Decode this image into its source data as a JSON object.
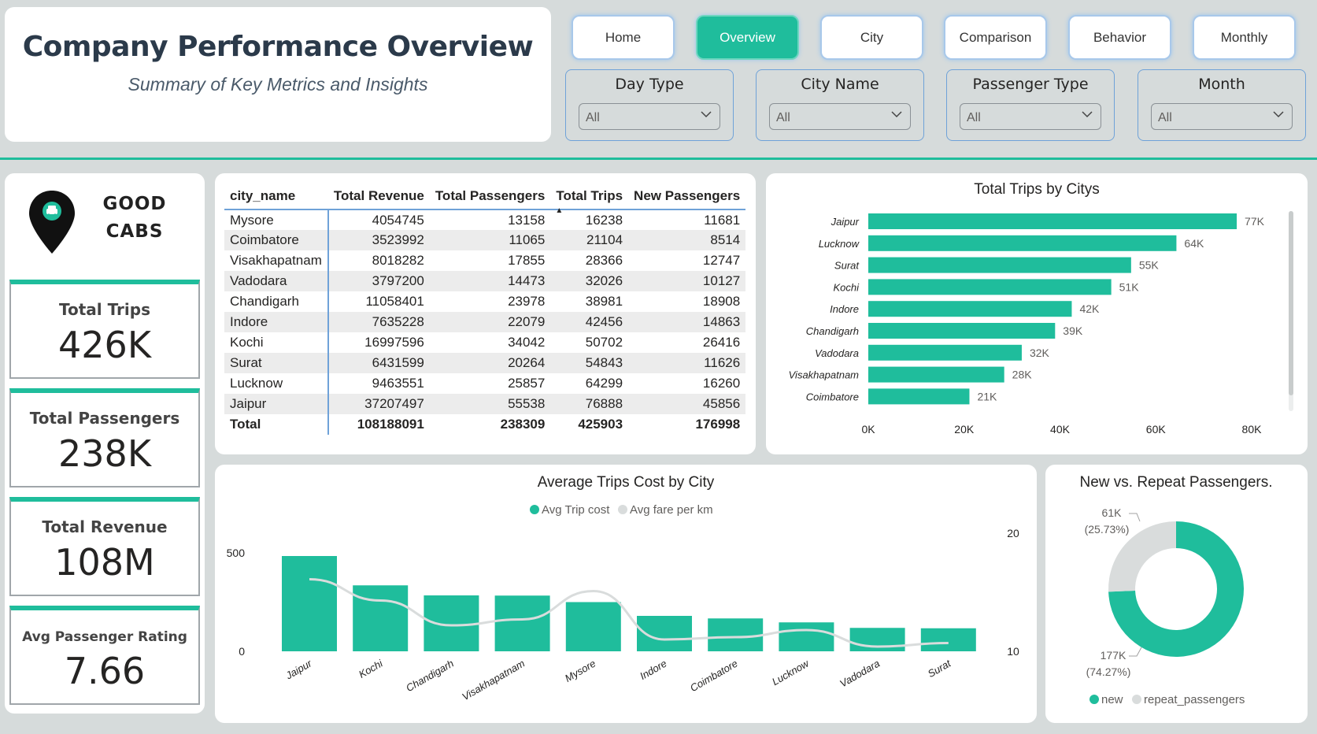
{
  "header": {
    "title": "Company Performance Overview",
    "subtitle": "Summary of Key Metrics and Insights"
  },
  "nav": [
    {
      "label": "Home",
      "active": false
    },
    {
      "label": "Overview",
      "active": true
    },
    {
      "label": "City",
      "active": false
    },
    {
      "label": "Comparison",
      "active": false
    },
    {
      "label": "Behavior",
      "active": false
    },
    {
      "label": "Monthly",
      "active": false
    }
  ],
  "filters": [
    {
      "label": "Day Type",
      "value": "All"
    },
    {
      "label": "City Name",
      "value": "All"
    },
    {
      "label": "Passenger Type",
      "value": "All"
    },
    {
      "label": "Month",
      "value": "All"
    }
  ],
  "brand": {
    "line1": "GOOD",
    "line2": "CABS"
  },
  "kpis": [
    {
      "label": "Total Trips",
      "value": "426K"
    },
    {
      "label": "Total Passengers",
      "value": "238K"
    },
    {
      "label": "Total Revenue",
      "value": "108M"
    },
    {
      "label": "Avg Passenger Rating",
      "value": "7.66"
    }
  ],
  "table": {
    "columns": [
      "city_name",
      "Total Revenue",
      "Total Passengers",
      "Total Trips",
      "New Passengers"
    ],
    "rows": [
      [
        "Mysore",
        "4054745",
        "13158",
        "16238",
        "11681"
      ],
      [
        "Coimbatore",
        "3523992",
        "11065",
        "21104",
        "8514"
      ],
      [
        "Visakhapatnam",
        "8018282",
        "17855",
        "28366",
        "12747"
      ],
      [
        "Vadodara",
        "3797200",
        "14473",
        "32026",
        "10127"
      ],
      [
        "Chandigarh",
        "11058401",
        "23978",
        "38981",
        "18908"
      ],
      [
        "Indore",
        "7635228",
        "22079",
        "42456",
        "14863"
      ],
      [
        "Kochi",
        "16997596",
        "34042",
        "50702",
        "26416"
      ],
      [
        "Surat",
        "6431599",
        "20264",
        "54843",
        "11626"
      ],
      [
        "Lucknow",
        "9463551",
        "25857",
        "64299",
        "16260"
      ],
      [
        "Jaipur",
        "37207497",
        "55538",
        "76888",
        "45856"
      ]
    ],
    "total": [
      "Total",
      "108188091",
      "238309",
      "425903",
      "176998"
    ]
  },
  "chart_data": [
    {
      "type": "bar",
      "orientation": "horizontal",
      "title": "Total Trips by Citys",
      "categories": [
        "Jaipur",
        "Lucknow",
        "Surat",
        "Kochi",
        "Indore",
        "Chandigarh",
        "Vadodara",
        "Visakhapatnam",
        "Coimbatore"
      ],
      "values": [
        76888,
        64299,
        54843,
        50702,
        42456,
        38981,
        32026,
        28366,
        21104
      ],
      "data_labels": [
        "77K",
        "64K",
        "55K",
        "51K",
        "42K",
        "39K",
        "32K",
        "28K",
        "21K"
      ],
      "xlim": [
        0,
        80000
      ],
      "xticks": [
        "0K",
        "20K",
        "40K",
        "60K",
        "80K"
      ],
      "color": "#1fbd9c"
    },
    {
      "type": "bar",
      "title": "Average Trips Cost by City",
      "legend": "top-center",
      "categories": [
        "Jaipur",
        "Kochi",
        "Chandigarh",
        "Visakhapatnam",
        "Mysore",
        "Indore",
        "Coimbatore",
        "Lucknow",
        "Vadodara",
        "Surat"
      ],
      "series": [
        {
          "name": "Avg Trip cost",
          "kind": "bar",
          "axis": "left",
          "color": "#1fbd9c",
          "values": [
            484,
            335,
            284,
            283,
            250,
            180,
            167,
            147,
            119,
            117
          ]
        },
        {
          "name": "Avg fare per km",
          "kind": "line",
          "axis": "right",
          "color": "#d9dcdc",
          "values": [
            16.1,
            14.3,
            12.2,
            12.7,
            15.1,
            11.0,
            11.2,
            11.8,
            10.4,
            10.7
          ]
        }
      ],
      "ylim_left": [
        0,
        500
      ],
      "yticks_left": [
        "0",
        "500"
      ],
      "ylim_right": [
        10,
        20
      ],
      "yticks_right": [
        "10",
        "20"
      ]
    },
    {
      "type": "pie",
      "variant": "donut",
      "title": "New vs. Repeat Passengers.",
      "legend": "bottom",
      "slices": [
        {
          "name": "new",
          "value": 177000,
          "label": "177K",
          "pct": "(74.27%)",
          "color": "#1fbd9c"
        },
        {
          "name": "repeat_passengers",
          "value": 61000,
          "label": "61K",
          "pct": "(25.73%)",
          "color": "#d9dcdc"
        }
      ]
    }
  ]
}
